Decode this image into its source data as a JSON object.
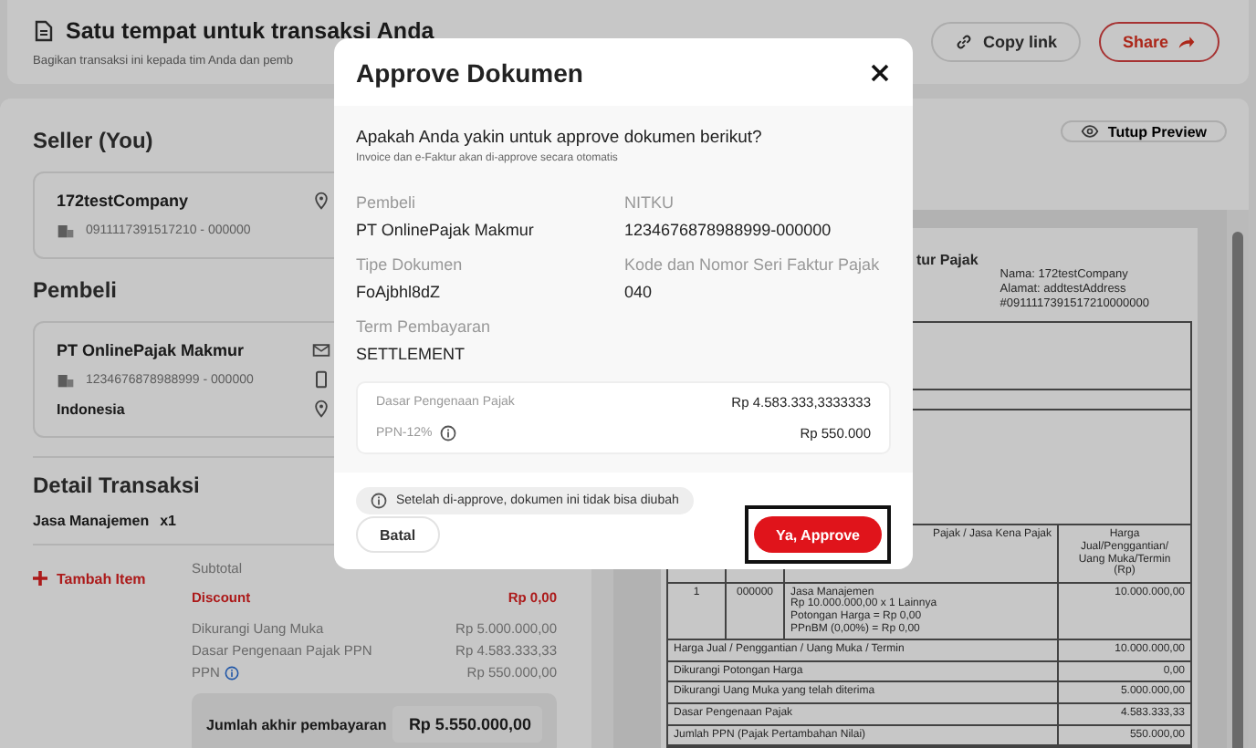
{
  "header": {
    "title": "Satu tempat untuk transaksi Anda",
    "subtitle": "Bagikan transaksi ini kepada tim Anda dan pemb",
    "buttons": [
      {
        "label": "Copy link",
        "kind": "secondary"
      },
      {
        "label": "Share",
        "kind": "primary"
      }
    ]
  },
  "seller": {
    "heading": "Seller (You)",
    "name": "172testCompany",
    "npwp": "0911117391517210 - 000000"
  },
  "buyer": {
    "heading": "Pembeli",
    "name": "PT OnlinePajak Makmur",
    "npwp": "1234676878988999 - 000000",
    "country": "Indonesia"
  },
  "transaction": {
    "heading": "Detail Transaksi",
    "item": "Jasa Manajemen",
    "quantity": "x1",
    "add_item": "Tambah Item",
    "summary": [
      {
        "label": "Subtotal",
        "kind": "plain",
        "info": false
      },
      {
        "label": "Discount",
        "value": "Rp 0,00",
        "kind": "discount",
        "info": false
      },
      {
        "label": "Dikurangi Uang Muka",
        "value": "Rp 5.000.000,00",
        "kind": "plain",
        "info": false
      },
      {
        "label": "Dasar Pengenaan Pajak PPN",
        "value": "Rp 4.583.333,33",
        "kind": "plain",
        "info": false
      },
      {
        "label": "PPN",
        "value": "Rp 550.000,00",
        "kind": "plain",
        "info": true
      }
    ],
    "total": {
      "label": "Jumlah akhir pembayaran",
      "value": "Rp 5.550.000,00"
    }
  },
  "preview": {
    "toggle": "Tutup Preview",
    "document": {
      "title": "tur Pajak",
      "seller_lines": [
        "Nama: 172testCompany",
        "Alamat: addtestAddress",
        "#0911117391517210000000"
      ],
      "table": {
        "header": [
          "Pajak / Jasa Kena Pajak",
          [
            "Harga Jual/Penggantian/",
            "Uang Muka/Termin",
            "(Rp)"
          ]
        ],
        "rows": [
          {
            "no": "1",
            "code": "000000",
            "description": [
              "Jasa Manajemen",
              "Rp 10.000.000,00 x 1 Lainnya",
              "Potongan Harga = Rp 0,00",
              "PPnBM (0,00%) = Rp 0,00"
            ],
            "amount": "10.000.000,00"
          }
        ],
        "totals": [
          {
            "label": "Harga Jual / Penggantian / Uang Muka / Termin",
            "value": "10.000.000,00"
          },
          {
            "label": "Dikurangi Potongan Harga",
            "value": "0,00"
          },
          {
            "label": "Dikurangi Uang Muka yang telah diterima",
            "value": "5.000.000,00"
          },
          {
            "label": "Dasar Pengenaan Pajak",
            "value": "4.583.333,33"
          },
          {
            "label": "Jumlah PPN (Pajak Pertambahan Nilai)",
            "value": "550.000,00"
          }
        ]
      }
    }
  },
  "modal": {
    "title": "Approve Dokumen",
    "question": "Apakah Anda yakin untuk approve dokumen berikut?",
    "note": "Invoice dan e-Faktur akan di-approve secara otomatis",
    "fields": [
      {
        "label": "Pembeli",
        "value": "PT OnlinePajak Makmur"
      },
      {
        "label": "NITKU",
        "value": "1234676878988999-000000"
      },
      {
        "label": "Tipe Dokumen",
        "value": "FoAjbhl8dZ"
      },
      {
        "label": "Kode dan Nomor Seri Faktur Pajak",
        "value": "040"
      },
      {
        "label": "Term Pembayaran",
        "value": "SETTLEMENT"
      }
    ],
    "tax": [
      {
        "label": "Dasar Pengenaan Pajak",
        "value": "Rp 4.583.333,3333333",
        "info": false
      },
      {
        "label": "PPN-12%",
        "value": "Rp 550.000",
        "info": true
      }
    ],
    "warning": "Setelah di-approve, dokumen ini tidak bisa diubah",
    "buttons": [
      {
        "label": "Batal",
        "kind": "secondary",
        "focused": false
      },
      {
        "label": "Ya, Approve",
        "kind": "primary",
        "focused": true
      }
    ]
  }
}
